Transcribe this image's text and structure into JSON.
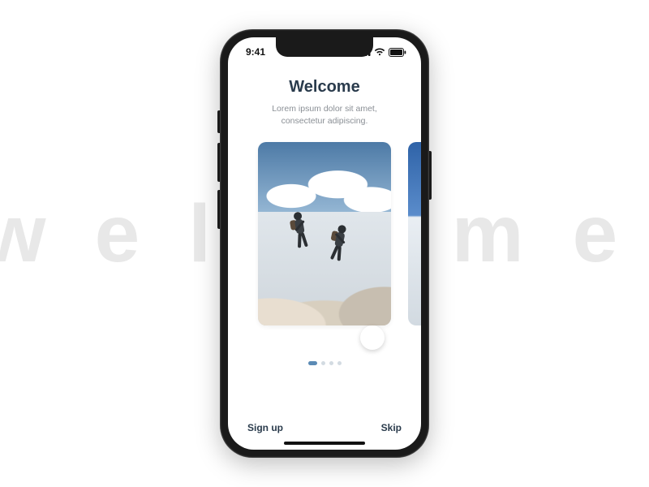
{
  "background_text": "welcome",
  "status": {
    "time": "9:41"
  },
  "onboarding": {
    "title": "Welcome",
    "subtitle": "Lorem ipsum dolor sit amet, consectetur adipiscing.",
    "page_count": 4,
    "active_page_index": 0
  },
  "footer": {
    "signup_label": "Sign up",
    "skip_label": "Skip"
  }
}
